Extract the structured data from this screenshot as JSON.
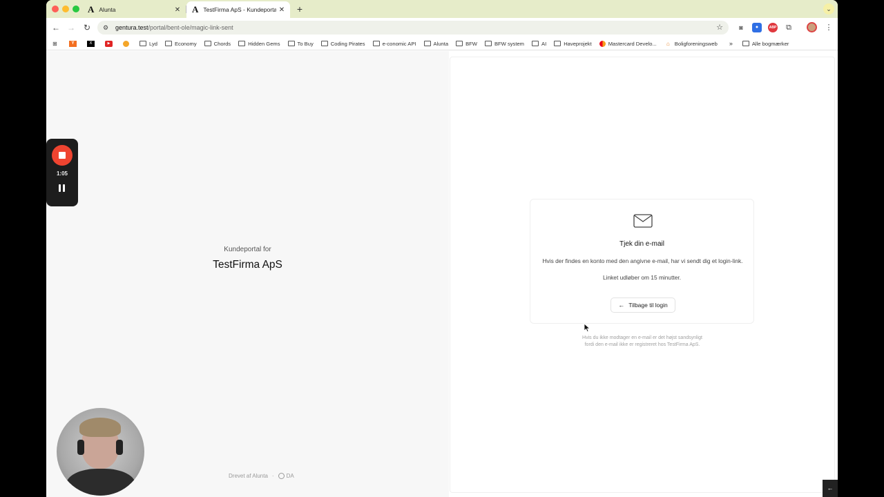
{
  "browser": {
    "tabs": [
      {
        "logo": "A",
        "title": "Alunta",
        "close": "✕"
      },
      {
        "logo": "A",
        "title": "TestFirma ApS - Kundeportal",
        "close": "✕"
      }
    ],
    "new_tab": "+",
    "url_host": "gentura.test",
    "url_path": "/portal/bent-ole/magic-link-sent",
    "bookmarks": [
      {
        "label": "",
        "icon": "apps-grid-icon"
      },
      {
        "label": "",
        "icon": "ycombinator-icon"
      },
      {
        "label": "",
        "icon": "x-icon"
      },
      {
        "label": "",
        "icon": "youtube-icon"
      },
      {
        "label": "",
        "icon": "emoji-icon"
      },
      {
        "label": "Lyd",
        "icon": "folder-icon"
      },
      {
        "label": "Economy",
        "icon": "folder-icon"
      },
      {
        "label": "Chords",
        "icon": "folder-icon"
      },
      {
        "label": "Hidden Gems",
        "icon": "folder-icon"
      },
      {
        "label": "To Buy",
        "icon": "folder-icon"
      },
      {
        "label": "Coding Pirates",
        "icon": "folder-icon"
      },
      {
        "label": "e-conomic API",
        "icon": "folder-icon"
      },
      {
        "label": "Alunta",
        "icon": "folder-icon"
      },
      {
        "label": "BFW",
        "icon": "folder-icon"
      },
      {
        "label": "BFW system",
        "icon": "folder-icon"
      },
      {
        "label": "AI",
        "icon": "folder-icon"
      },
      {
        "label": "Haveprojekt",
        "icon": "folder-icon"
      },
      {
        "label": "Mastercard Develo...",
        "icon": "mastercard-icon"
      },
      {
        "label": "Boligforeningsweb",
        "icon": "home-icon"
      }
    ],
    "bookmarks_more": "»",
    "all_bookmarks": "Alle bogmærker"
  },
  "left": {
    "brand_prefix": "Kundeportal for",
    "brand_name": "TestFirma ApS",
    "footer_powered": "Drevet af Alunta",
    "footer_sep": "·",
    "footer_lang": "DA"
  },
  "card": {
    "title": "Tjek din e-mail",
    "body": "Hvis der findes en konto med den angivne e-mail, har vi sendt dig et login-link.",
    "expiry": "Linket udløber om 15 minutter.",
    "back_label": "Tilbage til login",
    "hint": "Hvis du ikke modtager en e-mail er det højst sandsynligt fordi den e-mail ikke er registreret hos TestFirma ApS."
  },
  "recorder": {
    "time": "1:05"
  },
  "colors": {
    "tabstrip": "#e6ecc9",
    "record_red": "#ef4430",
    "left_bg": "#f7f7f7"
  }
}
